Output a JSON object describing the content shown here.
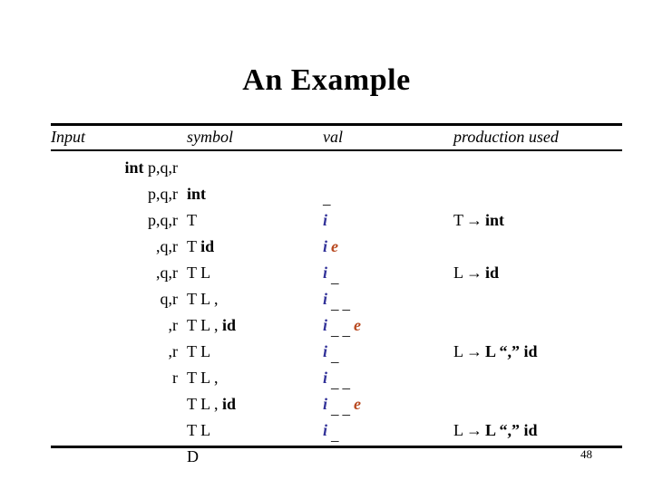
{
  "slide": {
    "title": "An Example",
    "page_number": "48"
  },
  "colors": {
    "text": "#000000",
    "val_i": "#333399",
    "val_e": "#B8481F",
    "rule": "#000000"
  },
  "table": {
    "headers": {
      "input": "Input",
      "symbol": "symbol",
      "val": "val",
      "production": "production used"
    },
    "rows": [
      {
        "input_bold": "int",
        "input_rest": "p,q,r",
        "symbol_plain": "",
        "symbol_bold": "",
        "val": "",
        "production_lhs": "",
        "production_rhs": ""
      },
      {
        "input_bold": "",
        "input_rest": "p,q,r",
        "symbol_plain": "",
        "symbol_bold": "int",
        "val": "_",
        "production_lhs": "",
        "production_rhs": ""
      },
      {
        "input_bold": "",
        "input_rest": "p,q,r",
        "symbol_plain": "T",
        "symbol_bold": "",
        "val": "i",
        "production_lhs": "T",
        "production_rhs": "int"
      },
      {
        "input_bold": "",
        "input_rest": ",q,r",
        "symbol_plain": "T",
        "symbol_bold": "id",
        "val": "i e",
        "production_lhs": "",
        "production_rhs": ""
      },
      {
        "input_bold": "",
        "input_rest": ",q,r",
        "symbol_plain": "T L",
        "symbol_bold": "",
        "val": "i _",
        "production_lhs": "L",
        "production_rhs": "id"
      },
      {
        "input_bold": "",
        "input_rest": "q,r",
        "symbol_plain": "T L ,",
        "symbol_bold": "",
        "val": "i _ _",
        "production_lhs": "",
        "production_rhs": ""
      },
      {
        "input_bold": "",
        "input_rest": ",r",
        "symbol_plain": "T L ,",
        "symbol_bold": "id",
        "val": "i _ _ e",
        "production_lhs": "",
        "production_rhs": ""
      },
      {
        "input_bold": "",
        "input_rest": ",r",
        "symbol_plain": "T L",
        "symbol_bold": "",
        "val": "i _",
        "production_lhs": "L",
        "production_rhs": "L “,” id"
      },
      {
        "input_bold": "",
        "input_rest": "r",
        "symbol_plain": "T L ,",
        "symbol_bold": "",
        "val": "i _ _",
        "production_lhs": "",
        "production_rhs": ""
      },
      {
        "input_bold": "",
        "input_rest": "",
        "symbol_plain": "T L ,",
        "symbol_bold": "id",
        "val": "i _ _ e",
        "production_lhs": "",
        "production_rhs": ""
      },
      {
        "input_bold": "",
        "input_rest": "",
        "symbol_plain": "T L",
        "symbol_bold": "",
        "val": "i _",
        "production_lhs": "L",
        "production_rhs": "L “,” id"
      },
      {
        "input_bold": "",
        "input_rest": "",
        "symbol_plain": "D",
        "symbol_bold": "",
        "val": "",
        "production_lhs": "",
        "production_rhs": ""
      }
    ],
    "arrow_glyph": "→"
  }
}
